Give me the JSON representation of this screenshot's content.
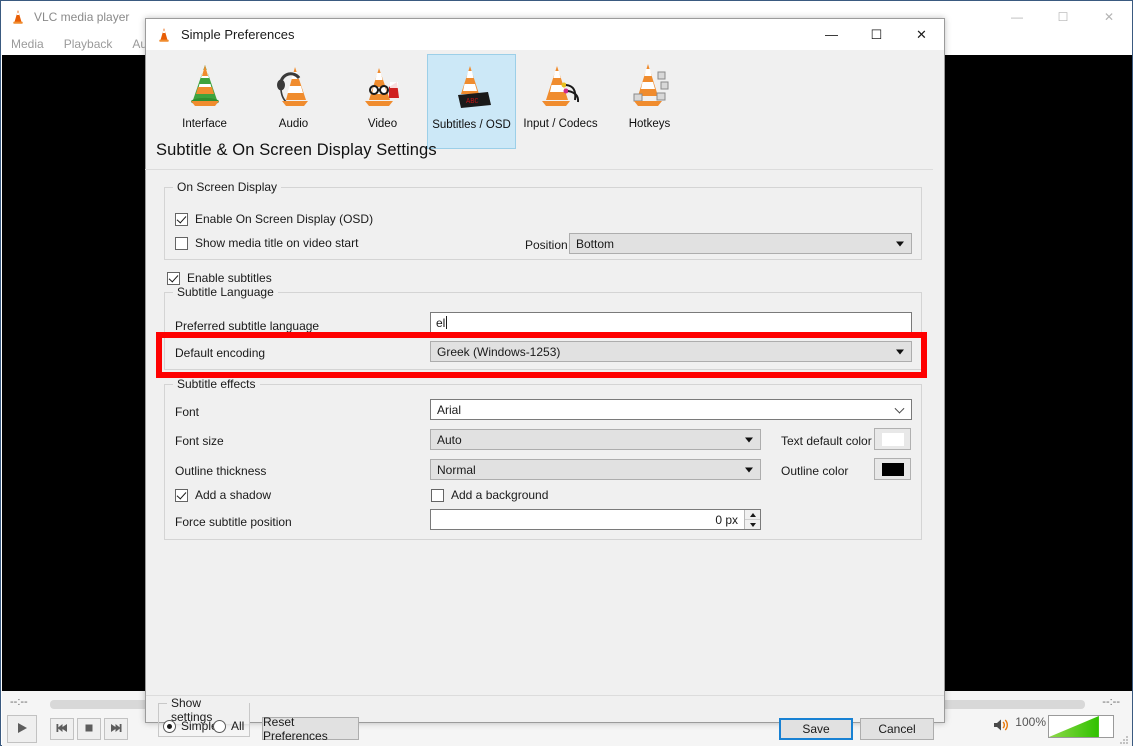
{
  "vlc_window": {
    "title": "VLC media player",
    "icon": "vlc-cone-icon",
    "menu": [
      "Media",
      "Playback",
      "Aud"
    ],
    "window_buttons": {
      "minimize": "—",
      "maximize": "☐",
      "close": "✕"
    },
    "time_elapsed": "--:--",
    "time_total": "--:--",
    "controls": {
      "play": "play-icon",
      "previous": "previous-icon",
      "stop": "stop-icon",
      "next": "next-icon"
    },
    "volume": {
      "label": "100%",
      "percent": 100,
      "icon": "speaker-icon",
      "fill_color": "#2fc100"
    }
  },
  "dialog": {
    "title": "Simple Preferences",
    "icon": "vlc-cone-icon",
    "window_buttons": {
      "minimize": "—",
      "maximize": "☐",
      "close": "✕"
    },
    "toolbar": [
      {
        "label": "Interface",
        "icon": "interface-cone-icon",
        "selected": false
      },
      {
        "label": "Audio",
        "icon": "audio-headphones-cone-icon",
        "selected": false
      },
      {
        "label": "Video",
        "icon": "video-glasses-cone-icon",
        "selected": false
      },
      {
        "label": "Subtitles / OSD",
        "icon": "subtitles-osd-cone-icon",
        "selected": true
      },
      {
        "label": "Input / Codecs",
        "icon": "input-codecs-cone-icon",
        "selected": false
      },
      {
        "label": "Hotkeys",
        "icon": "hotkeys-cone-icon",
        "selected": false
      }
    ],
    "heading": "Subtitle & On Screen Display Settings",
    "osd_group": {
      "legend": "On Screen Display",
      "enable_osd": {
        "label": "Enable On Screen Display (OSD)",
        "checked": true
      },
      "show_media_title": {
        "label": "Show media title on video start",
        "checked": false
      },
      "position": {
        "label": "Position",
        "value": "Bottom"
      }
    },
    "enable_subtitles": {
      "label": "Enable subtitles",
      "checked": true
    },
    "subtitle_language_group": {
      "legend": "Subtitle Language",
      "preferred_language": {
        "label": "Preferred subtitle language",
        "value": "el"
      },
      "default_encoding": {
        "label": "Default encoding",
        "value": "Greek (Windows-1253)"
      }
    },
    "subtitle_effects_group": {
      "legend": "Subtitle effects",
      "font": {
        "label": "Font",
        "value": "Arial"
      },
      "font_size": {
        "label": "Font size",
        "value": "Auto"
      },
      "outline_thickness": {
        "label": "Outline thickness",
        "value": "Normal"
      },
      "text_default_color": {
        "label": "Text default color",
        "color": "#ffffff"
      },
      "outline_color": {
        "label": "Outline color",
        "color": "#000000"
      },
      "add_shadow": {
        "label": "Add a shadow",
        "checked": true
      },
      "add_background": {
        "label": "Add a background",
        "checked": false
      },
      "force_subtitle_position": {
        "label": "Force subtitle position",
        "value": "0 px"
      }
    },
    "footer": {
      "show_settings_legend": "Show settings",
      "simple_label": "Simple",
      "all_label": "All",
      "simple_selected": true,
      "all_selected": false,
      "reset_label": "Reset Preferences",
      "save_label": "Save",
      "cancel_label": "Cancel"
    }
  },
  "annotation": {
    "highlight_color": "#fe0000",
    "target": "default-encoding-row"
  }
}
